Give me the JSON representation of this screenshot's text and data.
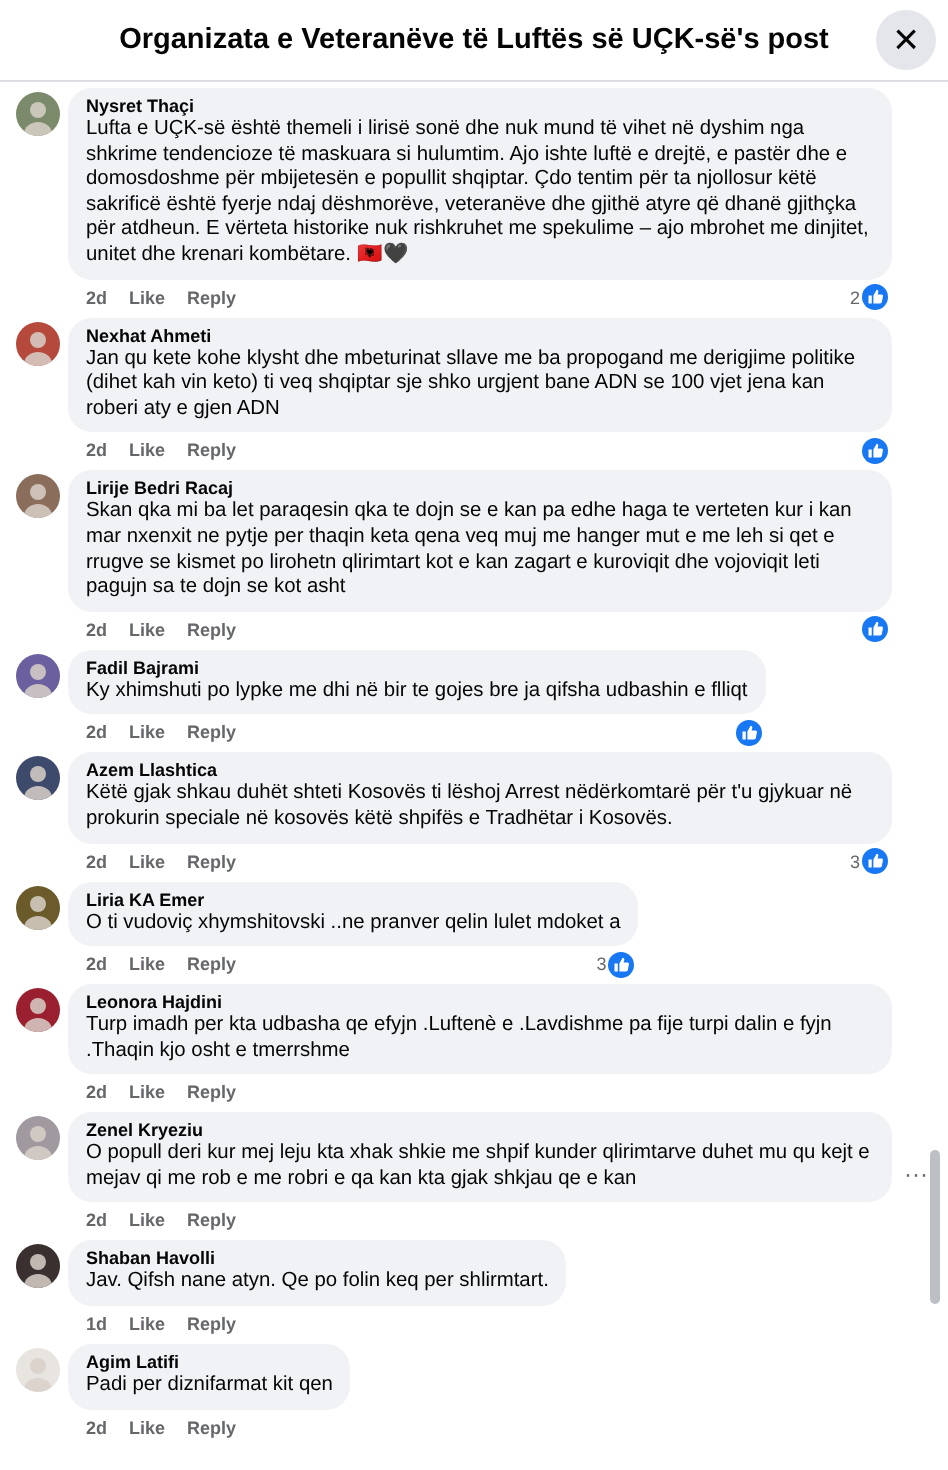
{
  "header": {
    "title": "Organizata e Veteranëve të Luftës së UÇK-së's post",
    "close": "×"
  },
  "comments": [
    {
      "author": "Nysret Thaçi",
      "text": "Lufta e UÇK-së është themeli i lirisë sonë dhe nuk mund të vihet në dyshim nga shkrime tendencioze të maskuara si hulumtim. Ajo ishte luftë e drejtë, e pastër dhe e domosdoshme për mbijetesën e popullit shqiptar. Çdo tentim për ta njollosur këtë sakrificë është fyerje ndaj dëshmorëve, veteranëve dhe gjithë atyre që dhanë gjithçka për atdheun. E vërteta historike nuk rishkruhet me spekulime – ajo mbrohet me dinjitet, unitet dhe krenari kombëtare. 🇦🇱🖤",
      "time": "2d",
      "like": "Like",
      "reply": "Reply",
      "liked_by_others": true,
      "reaction_count": "2"
    },
    {
      "author": "Nexhat Ahmeti",
      "text": "Jan qu kete kohe klysht dhe mbeturinat sllave me ba propogand me derigjime politike (dihet kah vin keto) ti veq shqiptar sje shko urgjent bane ADN se 100 vjet jena kan roberi aty e gjen ADN",
      "time": "2d",
      "like": "Like",
      "reply": "Reply",
      "liked_by_others": true
    },
    {
      "author": "Lirije Bedri Racaj",
      "text": "Skan qka mi ba let paraqesin qka te dojn se e kan pa edhe haga te verteten kur i kan mar nxenxit ne pytje per thaqin keta qena veq muj me hanger mut e me leh si qet e rrugve se kismet po lirohetn qlirimtart kot e kan zagart e kuroviqit dhe vojoviqit leti pagujn sa te dojn se kot asht",
      "time": "2d",
      "like": "Like",
      "reply": "Reply",
      "liked_by_others": true
    },
    {
      "author": "Fadil Bajrami",
      "text": "Ky xhimshuti po lypke me dhi në bir te gojes bre ja qifsha udbashin e flliqt",
      "time": "2d",
      "like": "Like",
      "reply": "Reply",
      "liked_by_others": true
    },
    {
      "author": "Azem Llashtica",
      "text": "Këtë gjak shkau duhët shteti Kosovës ti lëshoj Arrest nëdërkomtarë për t'u gjykuar në prokurin speciale në kosovës këtë shpifës e Tradhëtar i Kosovës.",
      "time": "2d",
      "like": "Like",
      "reply": "Reply",
      "liked_by_others": true,
      "reaction_count": "3"
    },
    {
      "author": "Liria KA Emer",
      "text": "O ti vudoviç xhymshitovski ..ne pranver qelin lulet mdoket a",
      "time": "2d",
      "like": "Like",
      "reply": "Reply",
      "liked_by_others": true,
      "reaction_count": "3"
    },
    {
      "author": "Leonora Hajdini",
      "text": "Turp imadh per kta udbasha qe efyjn .Luftenè e .Lavdishme pa fije turpi dalin e fyjn .Thaqin kjo osht e tmerrshme",
      "time": "2d",
      "like": "Like",
      "reply": "Reply",
      "liked_by_others": false
    },
    {
      "author": "Zenel Kryeziu",
      "text": "O popull deri kur mej leju kta xhak shkie me shpif kunder qlirimtarve duhet mu qu kejt e mejav qi me rob e me robri e qa kan kta gjak shkjau qe e kan",
      "time": "2d",
      "like": "Like",
      "reply": "Reply",
      "liked_by_others": false,
      "more": "···"
    },
    {
      "author": "Shaban Havolli",
      "text": "Jav. Qifsh nane atyn. Qe po folin keq per shlirmtart.",
      "time": "1d",
      "like": "Like",
      "reply": "Reply",
      "liked_by_others": false
    },
    {
      "author": "Agim Latifi",
      "text": "Padi per diznifarmat kit qen",
      "time": "2d",
      "like": "Like",
      "reply": "Reply",
      "liked_by_others": false
    }
  ]
}
